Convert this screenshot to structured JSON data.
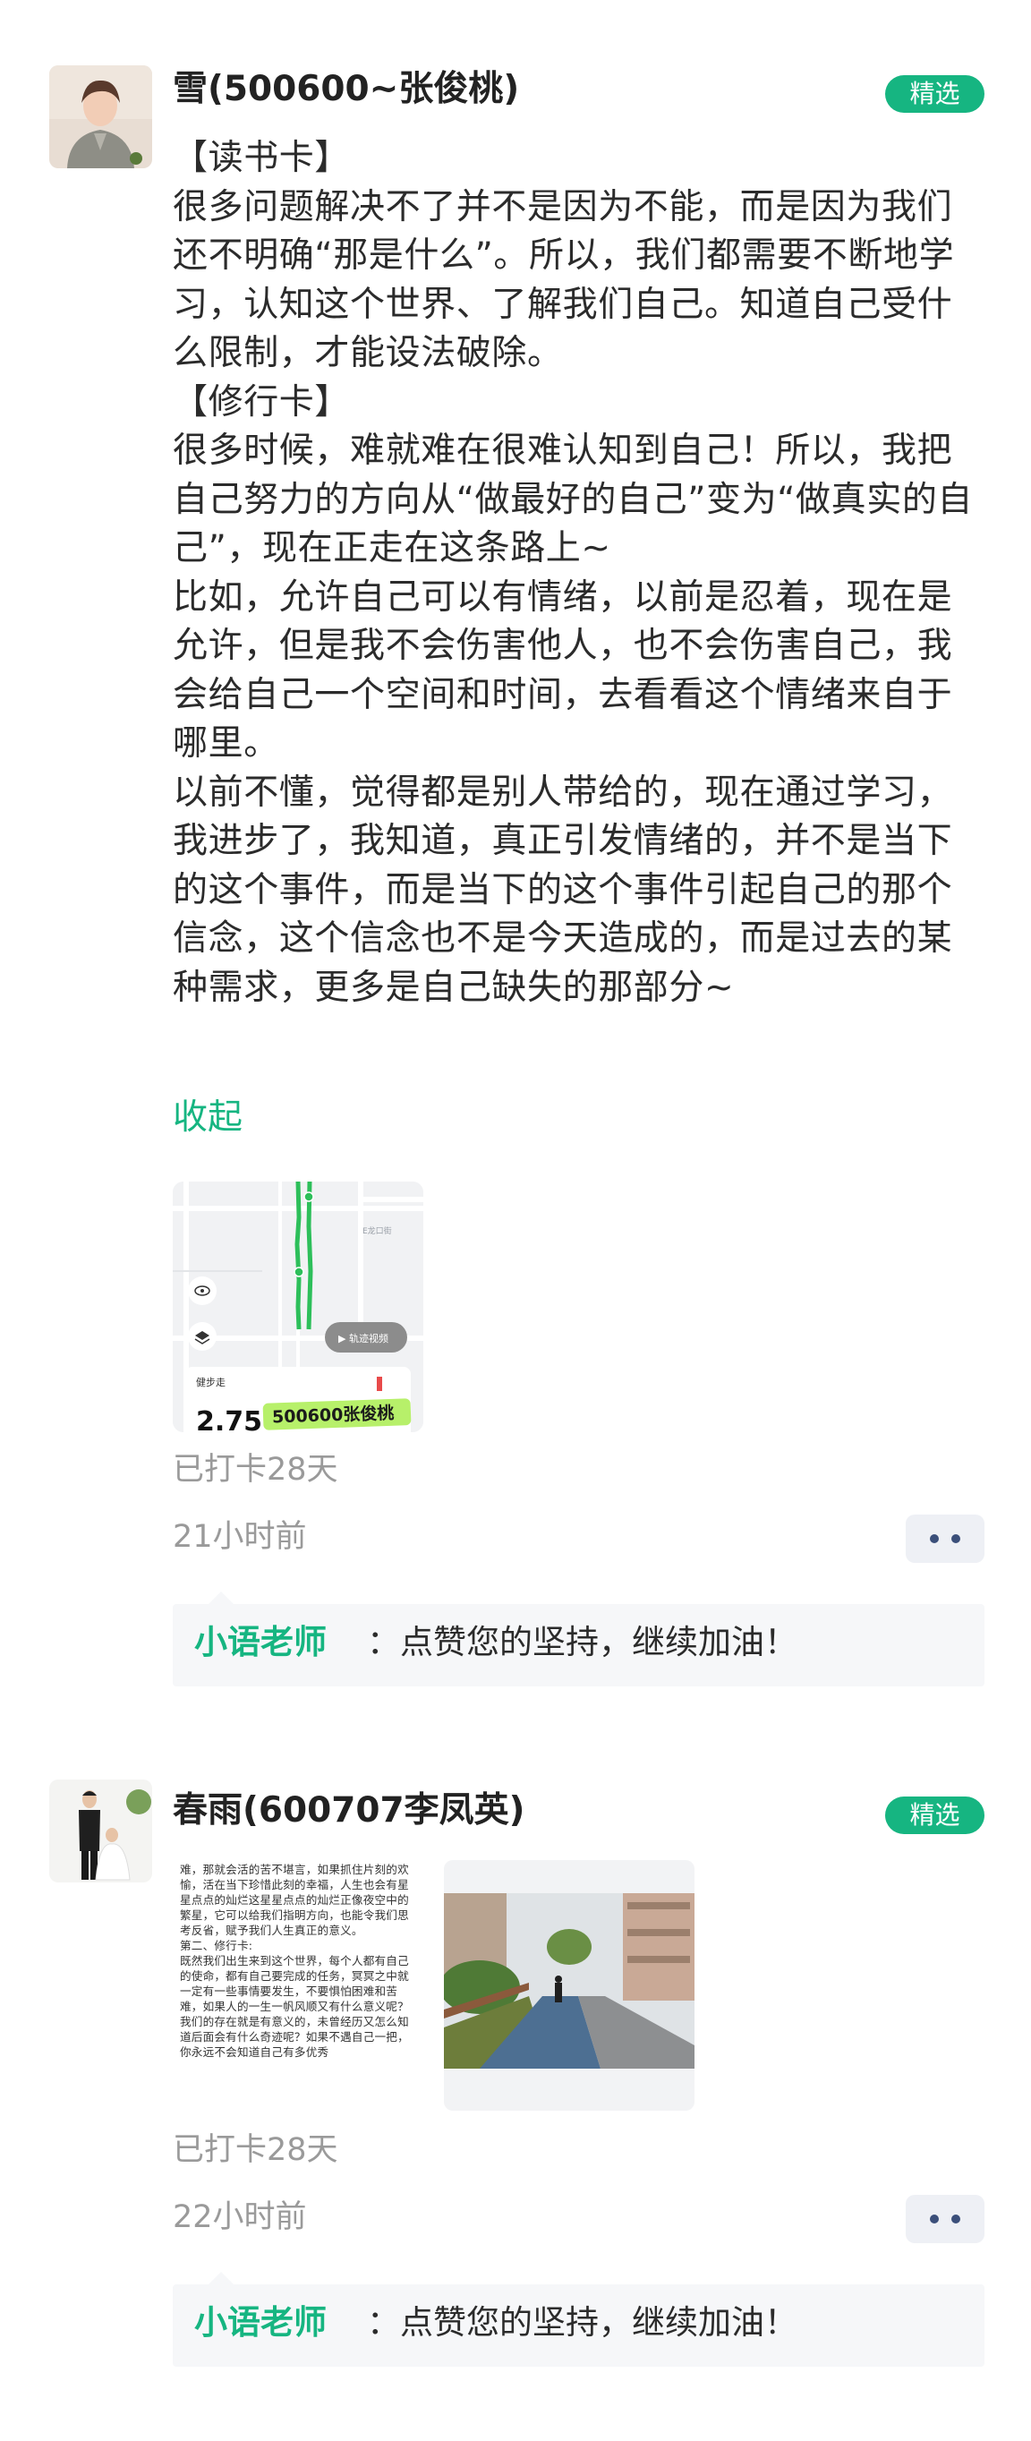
{
  "posts": [
    {
      "username": "雪(500600~张俊桃)",
      "badge": "精选",
      "paragraphs": [
        "【读书卡】",
        "很多问题解决不了并不是因为不能，而是因为我们还不明确“那是什么”。所以，我们都需要不断地学习，认知这个世界、了解我们自己。知道自己受什么限制，才能设法破除。",
        "【修行卡】",
        "很多时候，难就难在很难认知到自己！所以，我把自己努力的方向从“做最好的自己”变为“做真实的自己”，现在正走在这条路上~",
        "比如，允许自己可以有情绪，以前是忍着，现在是允许，但是我不会伤害他人，也不会伤害自己，我会给自己一个空间和时间，去看看这个情绪来自于哪里。",
        "以前不懂，觉得都是别人带给的，现在通过学习，我进步了，我知道，真正引发情绪的，并不是当下的这个事件，而是当下的这个事件引起自己的那个信念，这个信念也不是今天造成的，而是过去的某种需求，更多是自己缺失的那部分~"
      ],
      "collapse_label": "收起",
      "map": {
        "street_label": "E龙口街",
        "play_label": "▶ 轨迹视频",
        "activity_label": "健步走",
        "distance": "2.75",
        "watermark": "500600张俊桃"
      },
      "checkin": "已打卡28天",
      "time_ago": "21小时前",
      "comment": {
        "author": "小语老师",
        "text": "：点赞您的坚持，继续加油！"
      }
    },
    {
      "username": "春雨(600707李凤英)",
      "badge": "精选",
      "doc_text": "难，那就会活的苦不堪言，如果抓住片刻的欢愉，活在当下珍惜此刻的幸福，人生也会有星星点点的灿烂这星星点点的灿烂正像夜空中的繁星，它可以给我们指明方向，也能令我们思考反省，赋予我们人生真正的意义。\n第二、修行卡:\n    既然我们出生来到这个世界，每个人都有自己的使命，都有自己要完成的任务，冥冥之中就一定有一些事情要发生，不要惧怕困难和苦难，如果人的一生一帆风顺又有什么意义呢？我们的存在就是有意义的，未曾经历又怎么知道后面会有什么奇迹呢？如果不遇自己一把，你永远不会知道自己有多优秀",
      "checkin": "已打卡28天",
      "time_ago": "22小时前",
      "comment": {
        "author": "小语老师",
        "text": "：点赞您的坚持，继续加油！"
      }
    }
  ],
  "icons": [
    "avatar-photo",
    "eye-icon",
    "layers-icon",
    "play-icon",
    "more-dots-icon"
  ],
  "colors": {
    "accent": "#16b581",
    "secondary_text": "#9a9a9a",
    "more_dot": "#3b4f7a"
  }
}
